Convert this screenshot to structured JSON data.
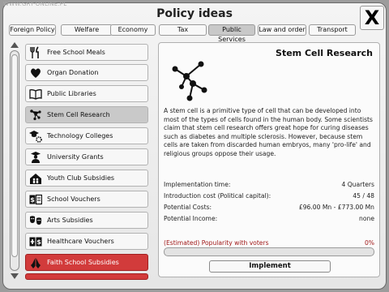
{
  "watermark": "WWW.GRY-ONLINE.PL",
  "window": {
    "title": "Policy ideas",
    "close_label": "X"
  },
  "tabs": [
    {
      "label": "Foreign Policy"
    },
    {
      "label": "Welfare"
    },
    {
      "label": "Economy"
    },
    {
      "label": "Tax"
    },
    {
      "label": "Public Services",
      "active": true
    },
    {
      "label": "Law and order"
    },
    {
      "label": "Transport"
    }
  ],
  "policies": [
    {
      "label": "Free School Meals",
      "icon": "fork-knife-icon"
    },
    {
      "label": "Organ Donation",
      "icon": "heart-icon"
    },
    {
      "label": "Public Libraries",
      "icon": "book-icon"
    },
    {
      "label": "Stem Cell Research",
      "icon": "molecule-icon",
      "selected": true
    },
    {
      "label": "Technology Colleges",
      "icon": "graduation-gear-icon"
    },
    {
      "label": "University Grants",
      "icon": "graduate-icon"
    },
    {
      "label": "Youth Club Subsidies",
      "icon": "house-people-icon"
    },
    {
      "label": "School Vouchers",
      "icon": "voucher-icon"
    },
    {
      "label": "Arts Subsidies",
      "icon": "theatre-masks-icon"
    },
    {
      "label": "Healthcare Vouchers",
      "icon": "health-voucher-icon"
    },
    {
      "label": "Faith School Subsidies",
      "icon": "praying-hands-icon",
      "highlight": "red"
    }
  ],
  "detail": {
    "title": "Stem Cell Research",
    "icon": "molecule-icon",
    "description": "A stem cell is a primitive type of cell that can be developed into most of the types of cells found in the human body. Some scientists claim that stem cell research offers great hope for curing diseases such as diabetes and multiple sclerosis. However, because stem cells are taken from discarded human embryos, many 'pro-life' and religious groups oppose their usage.",
    "stats": [
      {
        "label": "Implementation time:",
        "value": "4 Quarters"
      },
      {
        "label": "Introduction cost (Political capital):",
        "value": "45 / 48"
      },
      {
        "label": "Potential Costs:",
        "value": "£96.00 Mn - £773.00 Mn"
      },
      {
        "label": "Potential Income:",
        "value": "none"
      }
    ],
    "popularity_label": "(Estimated) Popularity with voters",
    "popularity_value": "0%",
    "popularity_fraction": 0,
    "implement_label": "Implement"
  },
  "colors": {
    "highlight_red": "#d23b3b",
    "popularity_text": "#a01818"
  }
}
